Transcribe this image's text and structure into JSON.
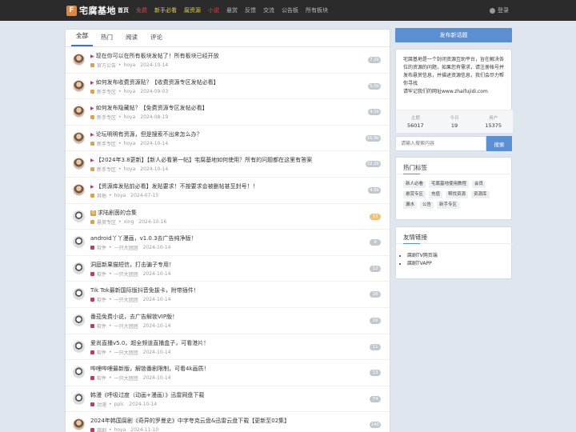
{
  "header": {
    "logo_text": "宅腐基地",
    "logo_mark": "F",
    "nav": [
      {
        "label": "首页",
        "active": true,
        "color": "#ffffff"
      },
      {
        "label": "免费",
        "active": false,
        "color": "#e04040"
      },
      {
        "label": "新手必看",
        "active": false,
        "color": "#e8d23a"
      },
      {
        "label": "腐资源",
        "active": false,
        "color": "#e8d23a"
      },
      {
        "label": "小说",
        "active": false,
        "color": "#e04040"
      },
      {
        "label": "悬赏",
        "active": false,
        "color": "#bbbbbb"
      },
      {
        "label": "反馈",
        "active": false,
        "color": "#bbbbbb"
      },
      {
        "label": "交流",
        "active": false,
        "color": "#bbbbbb"
      },
      {
        "label": "公告板",
        "active": false,
        "color": "#bbbbbb"
      },
      {
        "label": "所有板块",
        "active": false,
        "color": "#bbbbbb"
      }
    ],
    "login_label": "登录"
  },
  "tabs": [
    "全部",
    "热门",
    "阅读",
    "评论"
  ],
  "topics": [
    {
      "flag": "▶",
      "title": "现在你可以在所有板块发帖了！所有板块已经开放",
      "cat": "官方公告",
      "cat_color": "#e2a13b",
      "author": "hoya",
      "date": "2024-10-14",
      "count": "7.2k",
      "hot": false,
      "av": "a"
    },
    {
      "flag": "▶",
      "title": "如何发布收费资源贴？【收费资源专区发帖必看】",
      "cat": "新手专区",
      "cat_color": "#e2a13b",
      "author": "hoya",
      "date": "2024-09-03",
      "count": "5.5k",
      "hot": false,
      "av": "a"
    },
    {
      "flag": "▶",
      "title": "如何发布隐藏帖？【免费资源专区发帖必看】",
      "cat": "新手专区",
      "cat_color": "#e2a13b",
      "author": "hoya",
      "date": "2024-08-19",
      "count": "4.1k",
      "hot": false,
      "av": "a"
    },
    {
      "flag": "▶",
      "title": "论坛明明有资源，但是搜索不出来怎么办？",
      "cat": "新手专区",
      "cat_color": "#e2a13b",
      "author": "hoya",
      "date": "2024-10-14",
      "count": "16.9k",
      "hot": false,
      "av": "a"
    },
    {
      "flag": "▶",
      "title": "【2024年3.8更新】【新人必看第一帖】宅腐基地如何使用？所有的问题都在这里有答案",
      "cat": "新手专区",
      "cat_color": "#e2a13b",
      "author": "hoya",
      "date": "2024-10-14",
      "count": "32.2k",
      "hot": false,
      "av": "a"
    },
    {
      "flag": "▶",
      "title": "【资源库发贴前必看】发贴要求！不按要求会被删帖甚至封号！！",
      "cat": "其他",
      "cat_color": "#e2a13b",
      "author": "hoya",
      "date": "2024-07-15",
      "count": "4.8k",
      "hot": false,
      "av": "a"
    },
    {
      "flag": "Q",
      "title": "求陆剧茵的合集",
      "cat": "悬赏专区",
      "cat_color": "#e2a13b",
      "author": "xing",
      "date": "2024-10-16",
      "count": "13",
      "hot": true,
      "av": "b"
    },
    {
      "flag": "",
      "title": "android丫丫漫画，v1.0.3去广告纯净版！",
      "cat": "软件",
      "cat_color": "#d0335b",
      "author": "一只大团团",
      "date": "2024-10-14",
      "count": "9",
      "hot": false,
      "av": "b"
    },
    {
      "flag": "",
      "title": "洞庭新果猫短信，打击骗子专用！",
      "cat": "软件",
      "cat_color": "#d0335b",
      "author": "一只大团团",
      "date": "2024-10-14",
      "count": "12",
      "hot": false,
      "av": "b"
    },
    {
      "flag": "",
      "title": "Tik Tok最新国际版抖音免拔卡，附带插件！",
      "cat": "软件",
      "cat_color": "#d0335b",
      "author": "一只大团团",
      "date": "2024-10-14",
      "count": "16",
      "hot": false,
      "av": "b"
    },
    {
      "flag": "",
      "title": "番茄免费小说，去广告解锁VIP版！",
      "cat": "软件",
      "cat_color": "#d0335b",
      "author": "一只大团团",
      "date": "2024-10-14",
      "count": "16",
      "hot": false,
      "av": "b"
    },
    {
      "flag": "",
      "title": "爱尚直播v5.0，超全频道直播盒子，可看港片！",
      "cat": "软件",
      "cat_color": "#d0335b",
      "author": "一只大团团",
      "date": "2024-10-14",
      "count": "11",
      "hot": false,
      "av": "b"
    },
    {
      "flag": "",
      "title": "哔哩哔哩最新版，解锁番剧限制，可看4k画质！",
      "cat": "软件",
      "cat_color": "#d0335b",
      "author": "一只大团团",
      "date": "2024-10-14",
      "count": "13",
      "hot": false,
      "av": "b"
    },
    {
      "flag": "",
      "title": "韩漫《呼吸过度（动画+漫画）》迅雷网盘下载",
      "cat": "动漫",
      "cat_color": "#d0335b",
      "author": "pplc",
      "date": "2024-10-14",
      "count": "74",
      "hot": false,
      "av": "b"
    },
    {
      "flag": "",
      "title": "2024年韩国腐剧《奇异的罗曼史》中字夸克云盘&迅雷云盘下载【更新至02集】",
      "cat": "腐剧",
      "cat_color": "#d0335b",
      "author": "hoya",
      "date": "2024-11-10",
      "count": "140",
      "hot": false,
      "av": "a"
    }
  ],
  "sidebar": {
    "post_button": "发布新话题",
    "about_text": "宅腐基地是一个封闭资源互助平台，旨在解决各位的资源的问题，如果您有需求，请注册帐号并发布悬赏信息，并描述资源信息，我们会尽力帮你寻找",
    "about_link": "请牢记我们的网址www.zhaifujidi.com",
    "stats": [
      {
        "label": "主题",
        "value": "56017"
      },
      {
        "label": "今日",
        "value": "19"
      },
      {
        "label": "用户",
        "value": "15375"
      }
    ],
    "search_placeholder": "请输入搜索内容",
    "search_button": "搜索",
    "tags_title": "热门标签",
    "tags": [
      "新人必看",
      "宅腐基地使用教程",
      "会员",
      "悬赏专区",
      "充值",
      "帮找资源",
      "资源库",
      "漏水",
      "公告",
      "新手专区"
    ],
    "friends_title": "友情链接",
    "friends": [
      "腐剧TV网页端",
      "腐剧TVAPP"
    ]
  },
  "colors": {
    "accent": "#5b8fd4",
    "topbar": "#2b2b2b",
    "page_bg": "#dfe6ee"
  }
}
